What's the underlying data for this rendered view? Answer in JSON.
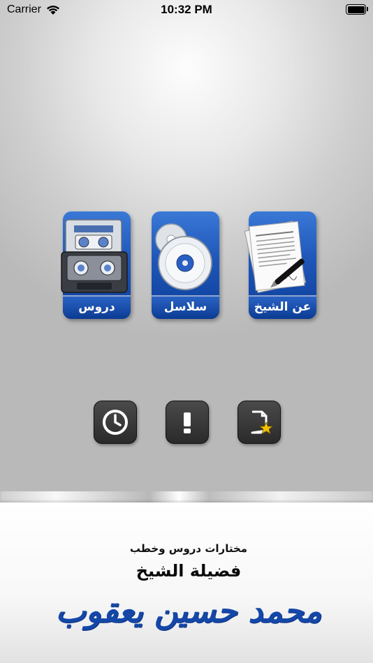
{
  "status_bar": {
    "carrier": "Carrier",
    "time": "10:32 PM"
  },
  "tiles": [
    {
      "label": "دروس",
      "icon": "cassette-tapes-icon"
    },
    {
      "label": "سلاسل",
      "icon": "cd-discs-icon"
    },
    {
      "label": "عن الشيخ",
      "icon": "document-pen-icon"
    }
  ],
  "buttons": [
    {
      "icon": "clock-icon"
    },
    {
      "icon": "exclamation-icon"
    },
    {
      "icon": "document-star-icon"
    }
  ],
  "footer": {
    "subtitle": "مختارات دروس وخطب",
    "title": "فضيلة الشيخ",
    "name": "محمد حسين يعقوب"
  },
  "colors": {
    "tile_blue": "#1e56b8",
    "button_dark": "#2f2f2f",
    "name_blue": "#1447a8",
    "star_yellow": "#f2c200"
  }
}
